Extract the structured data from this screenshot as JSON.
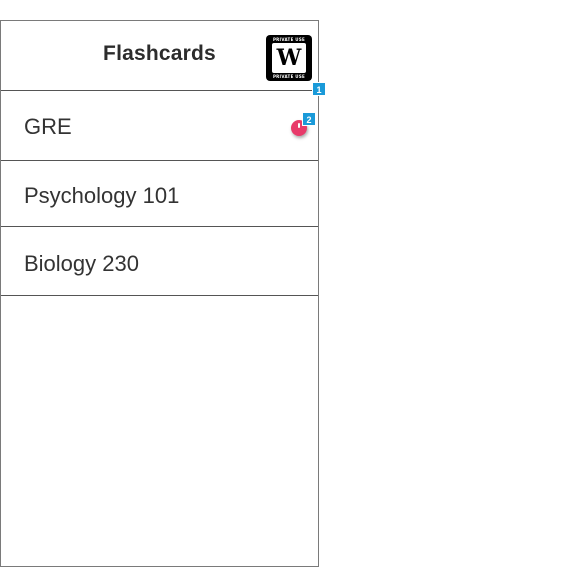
{
  "header": {
    "title": "Flashcards",
    "logo": {
      "text_top": "PRIVATE USE",
      "mark": "W",
      "text_bottom": "PRIVATE USE"
    }
  },
  "list": {
    "items": [
      {
        "label": "GRE"
      },
      {
        "label": "Psychology 101"
      },
      {
        "label": "Biology 230"
      }
    ]
  },
  "markers": [
    {
      "number": "1"
    },
    {
      "number": "2"
    }
  ],
  "colors": {
    "marker": "#1a9ad9",
    "indicator": "#e83a6a",
    "title": "#2c2c2c",
    "border": "#555555"
  },
  "icons": {
    "indicator": "notification-dot-icon",
    "logo": "logo-icon"
  }
}
